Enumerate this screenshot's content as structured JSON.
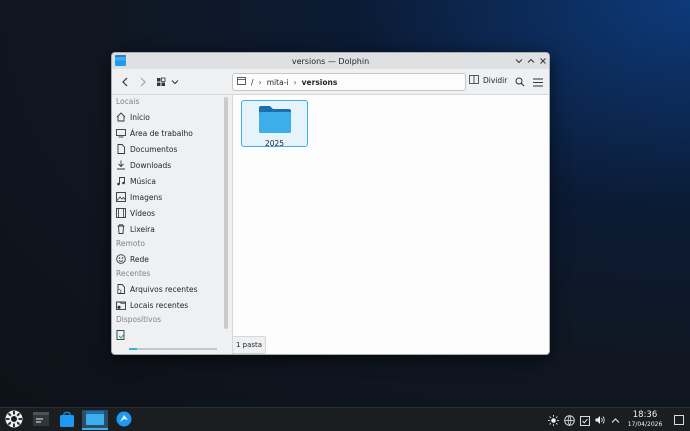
{
  "window": {
    "title": "versions — Dolphin"
  },
  "toolbar": {
    "breadcrumb": [
      "/",
      "mita-i",
      "versions"
    ],
    "split_label": "Dividir"
  },
  "sidebar": {
    "sections": {
      "places": "Locais",
      "remote": "Remoto",
      "recent": "Recentes",
      "devices": "Dispositivos"
    },
    "places": [
      {
        "label": "Início",
        "icon": "home-icon"
      },
      {
        "label": "Área de trabalho",
        "icon": "desktop-icon"
      },
      {
        "label": "Documentos",
        "icon": "documents-icon"
      },
      {
        "label": "Downloads",
        "icon": "downloads-icon"
      },
      {
        "label": "Música",
        "icon": "music-icon"
      },
      {
        "label": "Imagens",
        "icon": "images-icon"
      },
      {
        "label": "Vídeos",
        "icon": "videos-icon"
      },
      {
        "label": "Lixeira",
        "icon": "trash-icon"
      }
    ],
    "remote": [
      {
        "label": "Rede",
        "icon": "network-icon"
      }
    ],
    "recent": [
      {
        "label": "Arquivos recentes",
        "icon": "recent-files-icon"
      },
      {
        "label": "Locais recentes",
        "icon": "recent-locations-icon"
      }
    ],
    "device_usage_fraction": 0.09
  },
  "main": {
    "items": [
      {
        "name": "2025",
        "type": "folder"
      }
    ]
  },
  "status": {
    "text": "1 pasta"
  },
  "taskbar": {
    "clock_time": "18:36",
    "clock_date": "17/04/2026"
  },
  "colors": {
    "accent": "#3daee9",
    "folder": "#1d99f3"
  }
}
